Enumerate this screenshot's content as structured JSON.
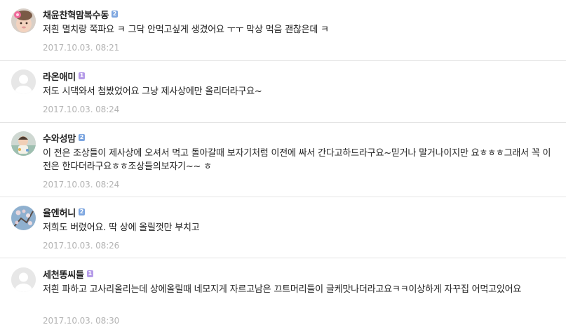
{
  "colors": {
    "badge_blue": "#7da6e0",
    "badge_purple": "#b59be8",
    "date_gray": "#b4b4b4",
    "divider": "#e4e4e4"
  },
  "comments": [
    {
      "nickname": "채윤찬혁맘복수동",
      "level": "2",
      "text": "저흰 멸치랑 쪽파요 ㅋ 그닥 안먹고싶게 생겼어요 ㅜㅜ 막상 먹음 괜찮은데 ㅋ",
      "date": "2017.10.03. 08:21",
      "avatar_icon": "baby-photo"
    },
    {
      "nickname": "라온애미",
      "level": "1",
      "text": "저도 시댁와서 첨봤었어요 그냥 제사상에만 올리더라구요~",
      "date": "2017.10.03. 08:24",
      "avatar_icon": "default-user-icon"
    },
    {
      "nickname": "수와성맘",
      "level": "2",
      "text": "이 전은 조상들이 제사상에 오셔서 먹고 돌아갈때 보자기처럼 이전에 싸서 간다고하드라구요~믿거나 말거나이지만 요ㅎㅎㅎ그래서 꼭 이전은 한다더라구요ㅎㅎ조상들의보자기~~ ㅎ",
      "date": "2017.10.03. 08:24",
      "avatar_icon": "child-photo"
    },
    {
      "nickname": "율엔허니",
      "level": "2",
      "text": "저희도 버렸어요. 딱 상에 올릴껏만 부치고",
      "date": "2017.10.03. 08:26",
      "avatar_icon": "blossom-photo"
    },
    {
      "nickname": "세천똥씨들",
      "level": "1",
      "text": "저흰 파하고 고사리올리는데 상에올릴때 네모지게 자르고남은 끄트머리들이 글케맛나더라고요ㅋㅋ이상하게 자꾸집 어먹고있어요",
      "date": "2017.10.03. 08:30",
      "avatar_icon": "default-user-icon"
    }
  ]
}
